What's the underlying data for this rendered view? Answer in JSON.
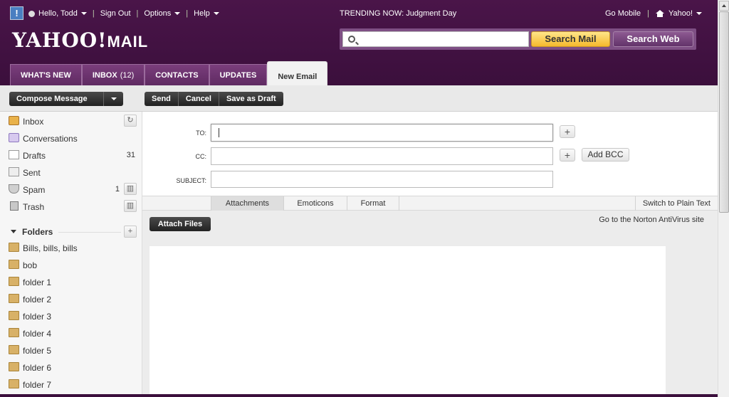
{
  "topbar": {
    "greeting": "Hello, Todd",
    "links": [
      "Sign Out",
      "Options",
      "Help"
    ],
    "trending": "TRENDING NOW: Judgment Day",
    "go_mobile": "Go Mobile",
    "yahoo": "Yahoo!"
  },
  "logo": {
    "brand": "YAHOO!",
    "product": "MAIL"
  },
  "search": {
    "placeholder": "",
    "mail_button": "Search Mail",
    "web_button": "Search Web"
  },
  "tabs": [
    {
      "label": "WHAT'S NEW",
      "count": ""
    },
    {
      "label": "INBOX",
      "count": "(12)"
    },
    {
      "label": "CONTACTS",
      "count": ""
    },
    {
      "label": "UPDATES",
      "count": ""
    },
    {
      "label": "New Email",
      "count": ""
    }
  ],
  "toolbar": {
    "compose": "Compose Message",
    "send": "Send",
    "cancel": "Cancel",
    "save_draft": "Save as Draft"
  },
  "sidebar": {
    "items": [
      {
        "label": "Inbox",
        "count": ""
      },
      {
        "label": "Conversations",
        "count": ""
      },
      {
        "label": "Drafts",
        "count": "31"
      },
      {
        "label": "Sent",
        "count": ""
      },
      {
        "label": "Spam",
        "count": "1"
      },
      {
        "label": "Trash",
        "count": ""
      }
    ],
    "folders_header": "Folders",
    "folders": [
      "Bills, bills, bills",
      "bob",
      "folder 1",
      "folder 2",
      "folder 3",
      "folder 4",
      "folder 5",
      "folder 6",
      "folder 7"
    ]
  },
  "compose": {
    "to_label": "TO:",
    "cc_label": "CC:",
    "subject_label": "SUBJECT:",
    "to_value": "",
    "cc_value": "",
    "subject_value": "",
    "add_bcc": "Add BCC",
    "plus": "+"
  },
  "format_tabs": [
    "Attachments",
    "Emoticons",
    "Format"
  ],
  "switch_plain": "Switch to Plain Text",
  "attach_files": "Attach Files",
  "norton": "Go to the Norton AntiVirus site",
  "colors": {
    "header": "#3b0f3c",
    "search_mail": "#f5b92c"
  }
}
